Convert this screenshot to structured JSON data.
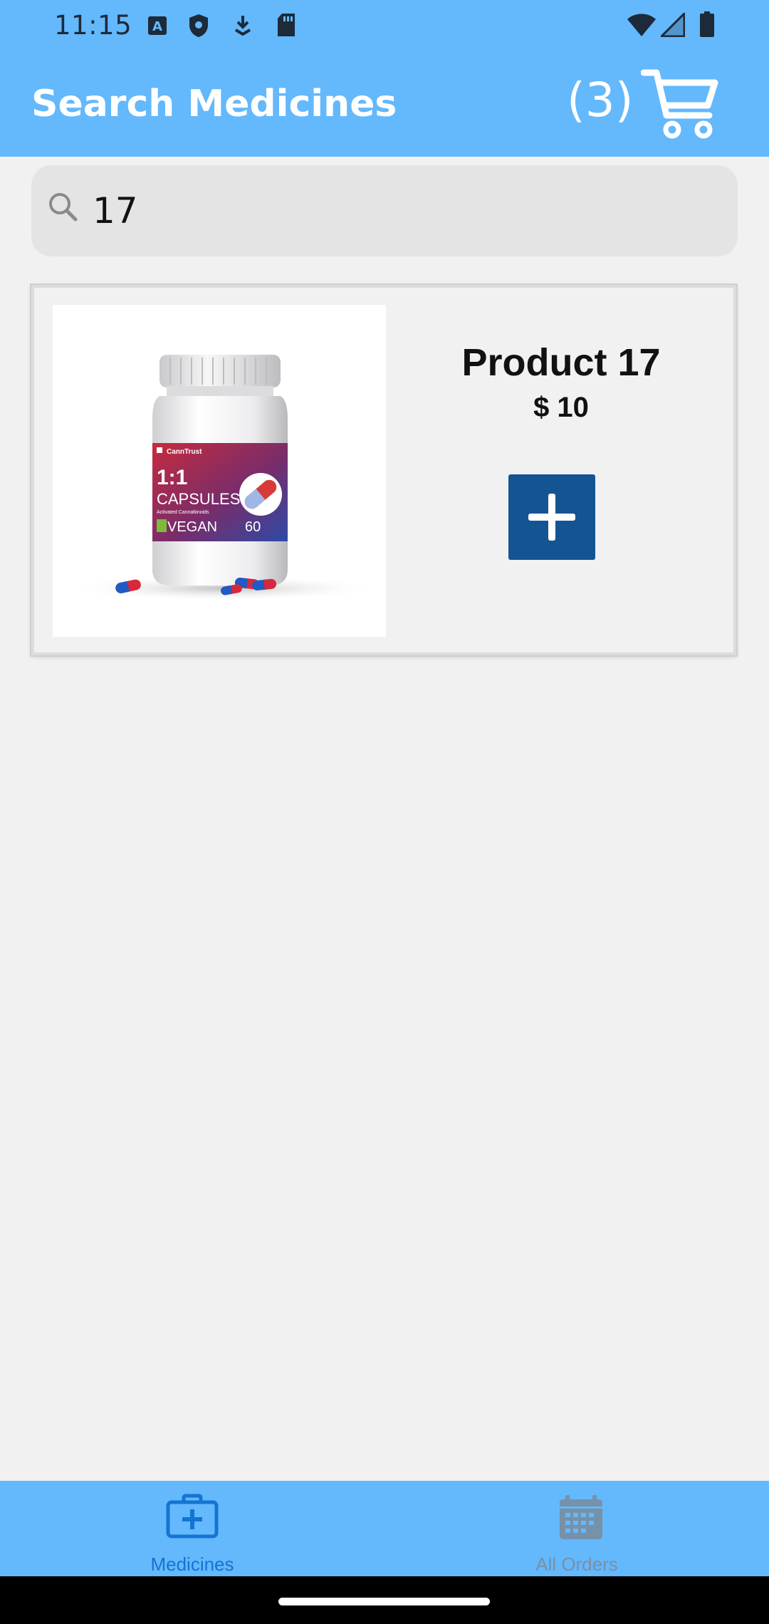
{
  "status_bar": {
    "time": "11:15",
    "icons": [
      "text-a-icon",
      "shield-icon",
      "download-icon",
      "sd-card-icon",
      "wifi-icon",
      "signal-icon",
      "battery-icon"
    ]
  },
  "app_bar": {
    "title": "Search Medicines",
    "cart_count": "(3)",
    "background": "#64b8fc"
  },
  "search": {
    "value": "17",
    "icon": "search-icon"
  },
  "products": [
    {
      "name": "Product 17",
      "price": "$ 10",
      "image": {
        "brand": "CannTrust",
        "ratio": "1:1",
        "line1": "CAPSULES",
        "line2": "Activated Cannabinoids",
        "tag": "VEGAN",
        "count": "60"
      },
      "add_icon": "plus-icon",
      "add_color": "#145493"
    }
  ],
  "bottom_nav": {
    "items": [
      {
        "label": "Medicines",
        "icon": "medical-kit-icon",
        "active": true
      },
      {
        "label": "All Orders",
        "icon": "calendar-icon",
        "active": false
      }
    ],
    "active_color": "#1474d4",
    "inactive_color": "#7691a8"
  }
}
